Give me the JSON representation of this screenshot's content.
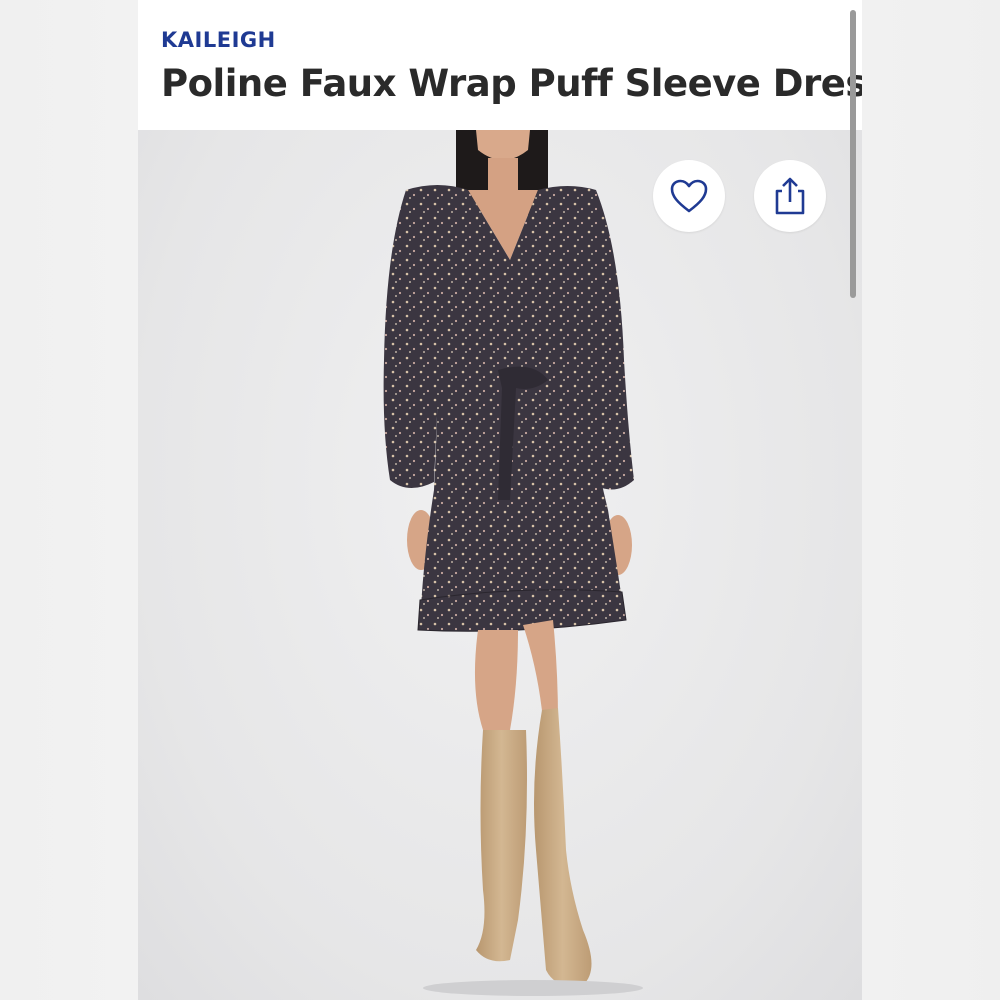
{
  "product": {
    "brand": "KAILEIGH",
    "title": "Poline Faux Wrap Puff Sleeve Dress"
  },
  "actions": {
    "favorite_icon": "heart-icon",
    "share_icon": "share-icon"
  },
  "colors": {
    "brand": "#1f3a93",
    "title": "#2a2a2a",
    "dress": "#3a3540",
    "boots": "#c9ab86"
  }
}
